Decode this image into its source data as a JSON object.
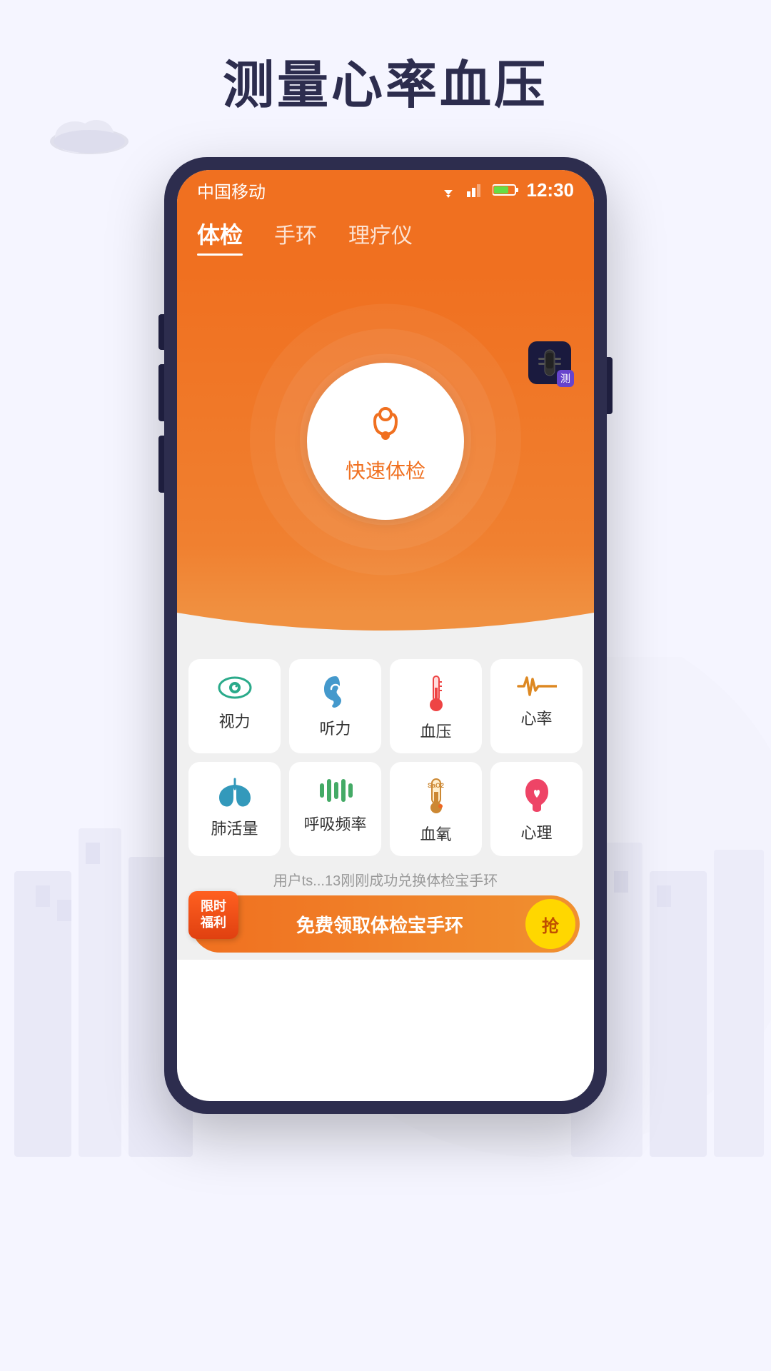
{
  "page": {
    "title": "测量心率血压",
    "bg_color": "#f0f0f8"
  },
  "status_bar": {
    "carrier": "中国移动",
    "time": "12:30"
  },
  "nav": {
    "tabs": [
      {
        "label": "体检",
        "active": true
      },
      {
        "label": "手环",
        "active": false
      },
      {
        "label": "理疗仪",
        "active": false
      }
    ]
  },
  "device_badge": {
    "label": "测"
  },
  "center_button": {
    "label": "快速体检"
  },
  "grid_rows": [
    [
      {
        "label": "视力",
        "icon": "eye"
      },
      {
        "label": "听力",
        "icon": "ear"
      },
      {
        "label": "血压",
        "icon": "bp"
      },
      {
        "label": "心率",
        "icon": "heartrate"
      }
    ],
    [
      {
        "label": "肺活量",
        "icon": "lung"
      },
      {
        "label": "呼吸频率",
        "icon": "breath"
      },
      {
        "label": "血氧",
        "icon": "blood"
      },
      {
        "label": "心理",
        "icon": "mind"
      }
    ]
  ],
  "notice_text": "用户ts...13刚刚成功兑换体检宝手环",
  "banner": {
    "tag_line1": "限时",
    "tag_line2": "福利",
    "text": "免费领取体检宝手环",
    "btn_label": "抢"
  }
}
